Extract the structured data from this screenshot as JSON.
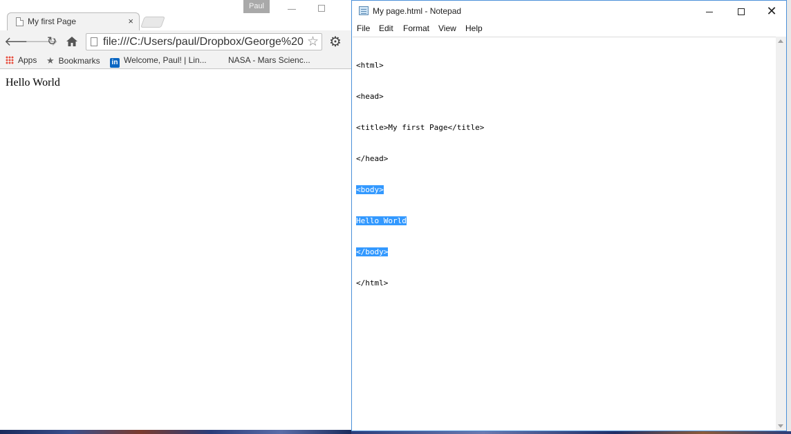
{
  "browser": {
    "tab_title": "My first Page",
    "tab_close": "×",
    "user_badge": "Paul",
    "url": "file:///C:/Users/paul/Dropbox/George%20",
    "bookmarks": [
      {
        "label": "Apps"
      },
      {
        "label": "Bookmarks"
      },
      {
        "label": "Welcome, Paul! | Lin..."
      },
      {
        "label": "NASA - Mars Scienc..."
      }
    ],
    "page_content": "Hello World"
  },
  "notepad": {
    "title": "My page.html - Notepad",
    "menu": [
      "File",
      "Edit",
      "Format",
      "View",
      "Help"
    ],
    "lines": [
      "<html>",
      "<head>",
      "<title>My first Page</title>",
      "</head>",
      "<body>",
      "Hello World",
      "</body>",
      "</html>"
    ],
    "selected_lines": [
      4,
      5,
      6
    ],
    "selection_color": "#3399ff"
  }
}
